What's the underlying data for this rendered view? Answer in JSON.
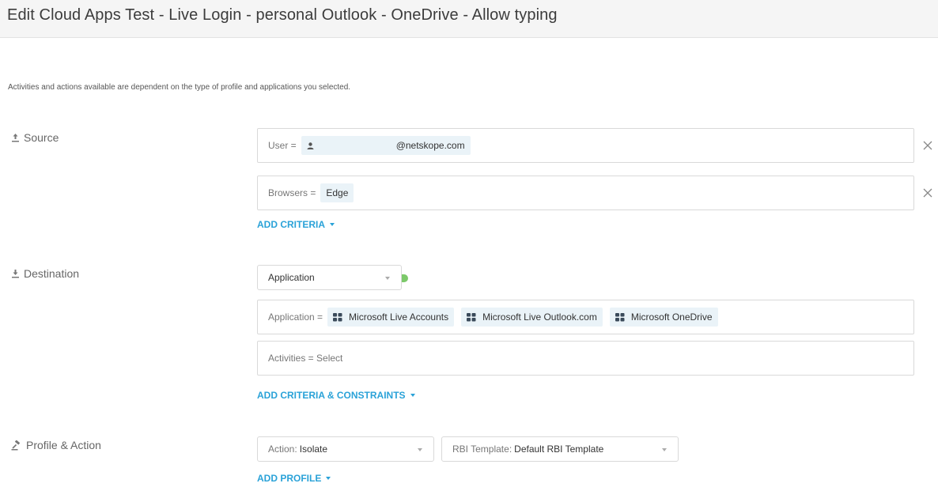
{
  "header": {
    "title": "Edit Cloud Apps Test - Live Login - personal Outlook - OneDrive - Allow typing"
  },
  "info_text": "Activities and actions available are dependent on the type of profile and applications you selected.",
  "source": {
    "label": "Source",
    "user_criteria": {
      "key": "User =",
      "value": "@netskope.com"
    },
    "browser_criteria": {
      "key": "Browsers =",
      "value": "Edge"
    },
    "add_criteria": "ADD CRITERIA"
  },
  "destination": {
    "label": "Destination",
    "type_select": "Application",
    "application_criteria": {
      "key": "Application =",
      "apps": [
        "Microsoft Live Accounts",
        "Microsoft Live Outlook.com",
        "Microsoft OneDrive"
      ]
    },
    "activities_criteria": {
      "text": "Activities = Select"
    },
    "add_criteria": "ADD CRITERIA & CONSTRAINTS"
  },
  "profile_action": {
    "label": "Profile & Action",
    "action_select": {
      "key": "Action:",
      "value": "Isolate"
    },
    "rbi_select": {
      "key": "RBI Template:",
      "value": "Default RBI Template"
    },
    "add_profile": "ADD PROFILE"
  },
  "colors": {
    "accent": "#2aa2d8",
    "chip_bg": "#eaf3f8",
    "toggle_on": "#7cc96a"
  }
}
